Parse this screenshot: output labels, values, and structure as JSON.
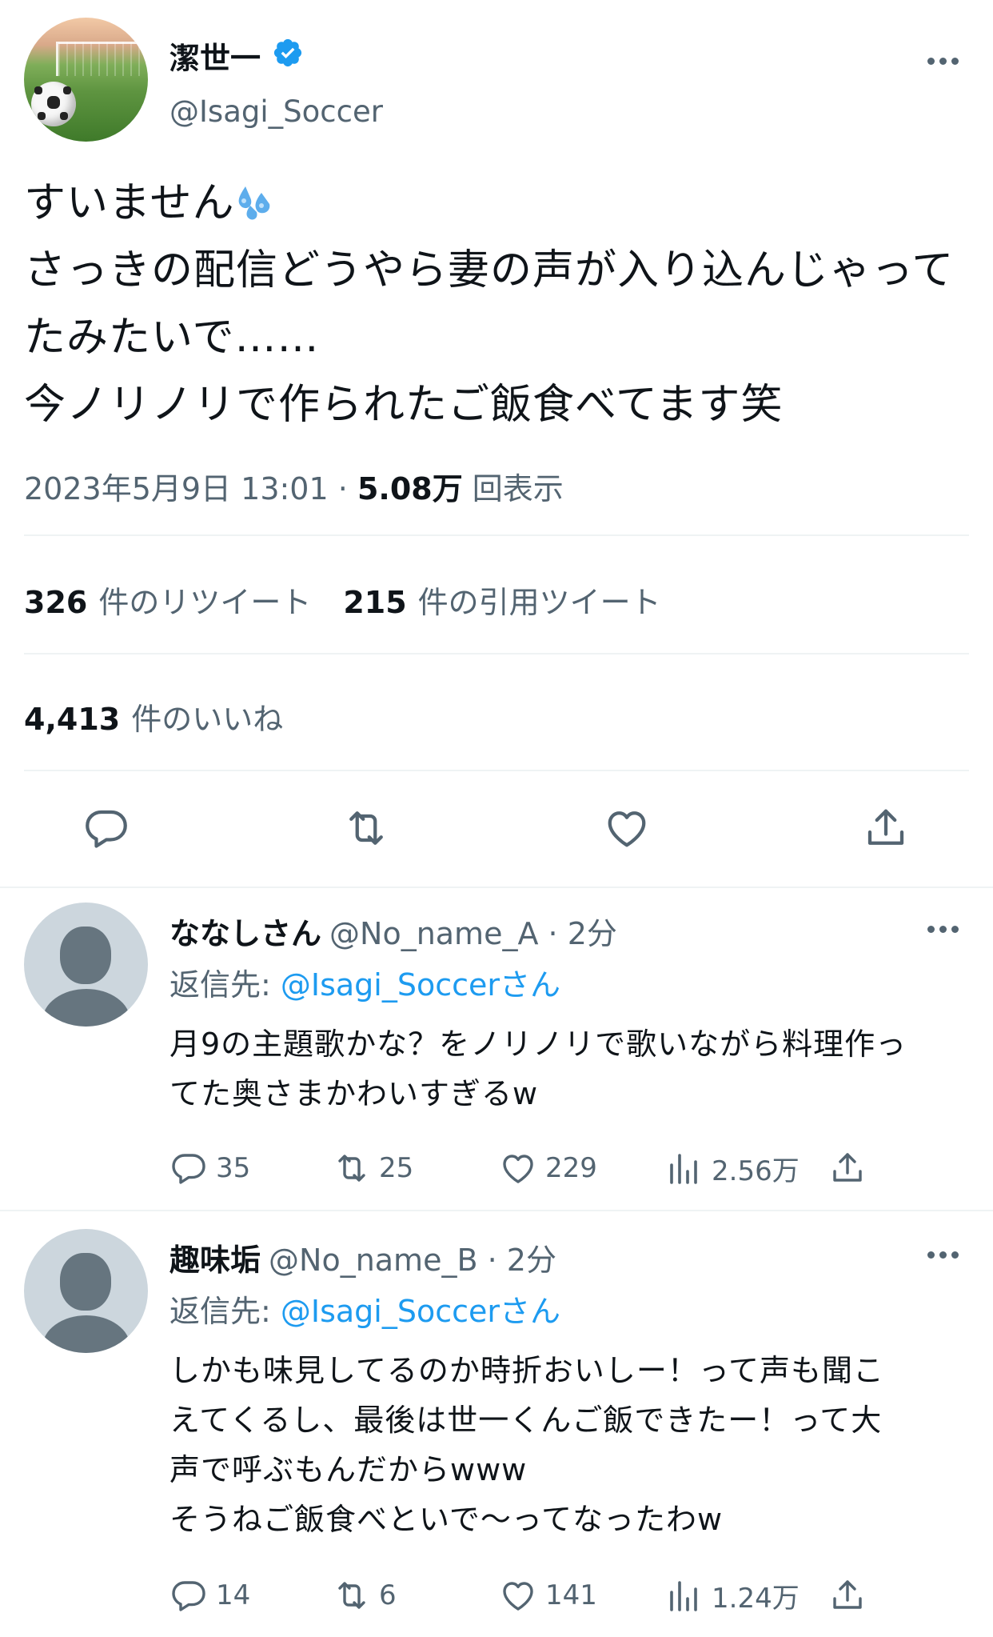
{
  "tweet": {
    "author_name": "潔世一",
    "author_handle": "@Isagi_Soccer",
    "lines": [
      "すいません",
      "さっきの配信どうやら妻の声が入り込んじゃって",
      "たみたいで……",
      "今ノリノリで作られたご飯食べてます笑"
    ],
    "timestamp": "2023年5月9日 13:01",
    "separator": "·",
    "views": "5.08万",
    "views_label": "回表示",
    "retweets": "326",
    "retweets_label": "件のリツイート",
    "quotes": "215",
    "quotes_label": "件の引用ツイート",
    "likes": "4,413",
    "likes_label": "件のいいね",
    "icons": [
      "verified-badge-icon",
      "more-icon",
      "reply-icon",
      "retweet-icon",
      "like-icon",
      "share-icon",
      "sweat-droplets-emoji"
    ],
    "colors": {
      "verified": "#1d9bf0",
      "muted": "#536471",
      "text": "#0f1419",
      "link": "#1d9bf0"
    }
  },
  "replies": [
    {
      "name": "ななしさん",
      "handle": "@No_name_A",
      "time": "· 2分",
      "reply_to_label": "返信先: ",
      "reply_to_mention": "@Isagi_Soccerさん",
      "text": "月9の主題歌かな？をノリノリで歌いながら料理作っ\nてた奥さまかわいすぎるw",
      "replies": "35",
      "retweets": "25",
      "likes": "229",
      "views": "2.56万"
    },
    {
      "name": "趣味垢",
      "handle": "@No_name_B",
      "time": "· 2分",
      "reply_to_label": "返信先: ",
      "reply_to_mention": "@Isagi_Soccerさん",
      "text": "しかも味見してるのか時折おいしー！って声も聞こ\nえてくるし、最後は世一くんご飯できたー！って大\n声で呼ぶもんだからwww\nそうねご飯食べといで〜ってなったわw",
      "replies": "14",
      "retweets": "6",
      "likes": "141",
      "views": "1.24万"
    }
  ]
}
